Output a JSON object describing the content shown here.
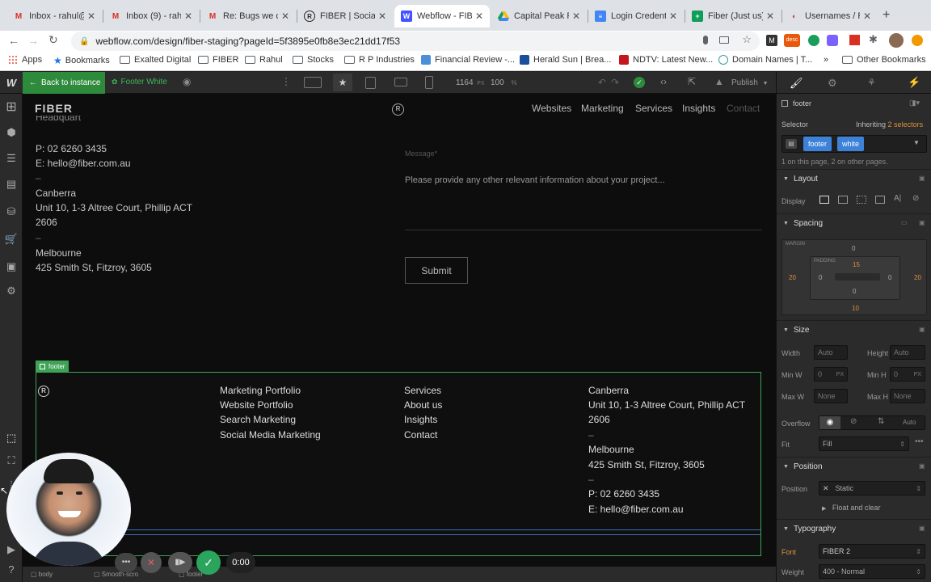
{
  "browser": {
    "tabs": [
      {
        "label": "Inbox - rahul@",
        "icon": "gmail-icon",
        "color": "#d93025"
      },
      {
        "label": "Inbox (9) - rahu",
        "icon": "gmail-icon",
        "color": "#d93025"
      },
      {
        "label": "Re: Bugs we ca",
        "icon": "gmail-icon",
        "color": "#d93025"
      },
      {
        "label": "FIBER | Social",
        "icon": "fiber-icon",
        "color": "#222"
      },
      {
        "label": "Webflow - FIB",
        "icon": "webflow-icon",
        "color": "#4353ff"
      },
      {
        "label": "Capital Peak P",
        "icon": "drive-icon",
        "color": "#1a73e8"
      },
      {
        "label": "Login Credenti",
        "icon": "docs-icon",
        "color": "#4285f4"
      },
      {
        "label": "Fiber (Just us)",
        "icon": "sheets-icon",
        "color": "#0f9d58"
      },
      {
        "label": "Usernames / P",
        "icon": "tab-icon",
        "color": "#d93025"
      }
    ],
    "url": "webflow.com/design/fiber-staging?pageId=5f3895e0fb8e3ec21dd17f53",
    "bookmarks": [
      {
        "label": "Apps",
        "type": "apps"
      },
      {
        "label": "Bookmarks",
        "type": "star"
      },
      {
        "label": "Exalted Digital",
        "type": "folder"
      },
      {
        "label": "FIBER",
        "type": "folder"
      },
      {
        "label": "Rahul",
        "type": "folder"
      },
      {
        "label": "Stocks",
        "type": "folder"
      },
      {
        "label": "R P Industries",
        "type": "folder"
      },
      {
        "label": "Financial Review -...",
        "type": "site"
      },
      {
        "label": "Herald Sun | Brea...",
        "type": "site"
      },
      {
        "label": "NDTV: Latest New...",
        "type": "site"
      },
      {
        "label": "Domain Names | T...",
        "type": "site"
      }
    ],
    "more_bookmarks": "»",
    "other_bookmarks": "Other Bookmarks"
  },
  "webflow_top": {
    "back_label": "Back to instance",
    "symbol_label": "Footer White",
    "width_value": "1164",
    "width_unit": "PX",
    "zoom_value": "100",
    "zoom_unit": "%",
    "publish_label": "Publish"
  },
  "canvas": {
    "logo": "FIBER",
    "nav": [
      "Websites",
      "Marketing",
      "Services",
      "Insights",
      "Contact"
    ],
    "clipped_text": "Headquart",
    "contact_left": {
      "phone": "P: 02 6260 3435",
      "email": "E: hello@fiber.com.au",
      "dash1": "–",
      "city1": "Canberra",
      "addr1a": "Unit 10, 1-3 Altree Court, Phillip ACT",
      "addr1b": "2606",
      "dash2": "–",
      "city2": "Melbourne",
      "addr2": "425 Smith St, Fitzroy, 3605"
    },
    "message_label": "Message*",
    "message_placeholder": "Please provide any other relevant information about your project...",
    "submit_label": "Submit",
    "footer_tag": "footer",
    "footer_col1": [
      "Marketing Portfolio",
      "Website Portfolio",
      "Search Marketing",
      "Social Media Marketing"
    ],
    "footer_col2": [
      "Services",
      "About us",
      "Insights",
      "Contact"
    ],
    "footer_col3": {
      "city1": "Canberra",
      "addr1a": "Unit 10, 1-3 Altree Court, Phillip ACT",
      "addr1b": "2606",
      "dash1": "–",
      "city2": "Melbourne",
      "addr2": "425 Smith St, Fitzroy, 3605",
      "dash2": "–",
      "phone": "P: 02 6260 3435",
      "email": "E: hello@fiber.com.au"
    }
  },
  "breadcrumbs": [
    "body",
    "Smooth-scro",
    "footer"
  ],
  "recorder": {
    "time": "0:00"
  },
  "panel": {
    "element_label": "footer",
    "selector_label": "Selector",
    "inheriting_label": "Inheriting",
    "inheriting_count": "2 selectors",
    "class_pills": [
      "footer",
      "white"
    ],
    "usage_note": "1 on this page, 2 on other pages.",
    "layout_title": "Layout",
    "display_label": "Display",
    "spacing_title": "Spacing",
    "margin_label": "MARGIN",
    "padding_label": "PADDING",
    "margin": {
      "top": "0",
      "left": "20",
      "right": "20",
      "bottom": "10"
    },
    "padding": {
      "top": "15",
      "left": "0",
      "right": "0",
      "bottom": "0"
    },
    "size_title": "Size",
    "width_label": "Width",
    "width_val": "Auto",
    "height_label": "Height",
    "height_val": "Auto",
    "minw_label": "Min W",
    "minw_val": "0",
    "minh_label": "Min H",
    "minh_val": "0",
    "px": "PX",
    "maxw_label": "Max W",
    "maxw_val": "None",
    "maxh_label": "Max H",
    "maxh_val": "None",
    "overflow_label": "Overflow",
    "overflow_auto": "Auto",
    "fit_label": "Fit",
    "fit_val": "Fill",
    "position_title": "Position",
    "position_label": "Position",
    "position_val": "Static",
    "float_label": "Float and clear",
    "typography_title": "Typography",
    "font_label": "Font",
    "font_val": "FIBER 2",
    "weight_label": "Weight",
    "weight_val": "400 - Normal"
  },
  "colors": {
    "webflow_green": "#2e8b3c",
    "selection_blue": "#3d82d9",
    "spacing_orange": "#e0903a",
    "footer_outline": "#3fa356"
  }
}
